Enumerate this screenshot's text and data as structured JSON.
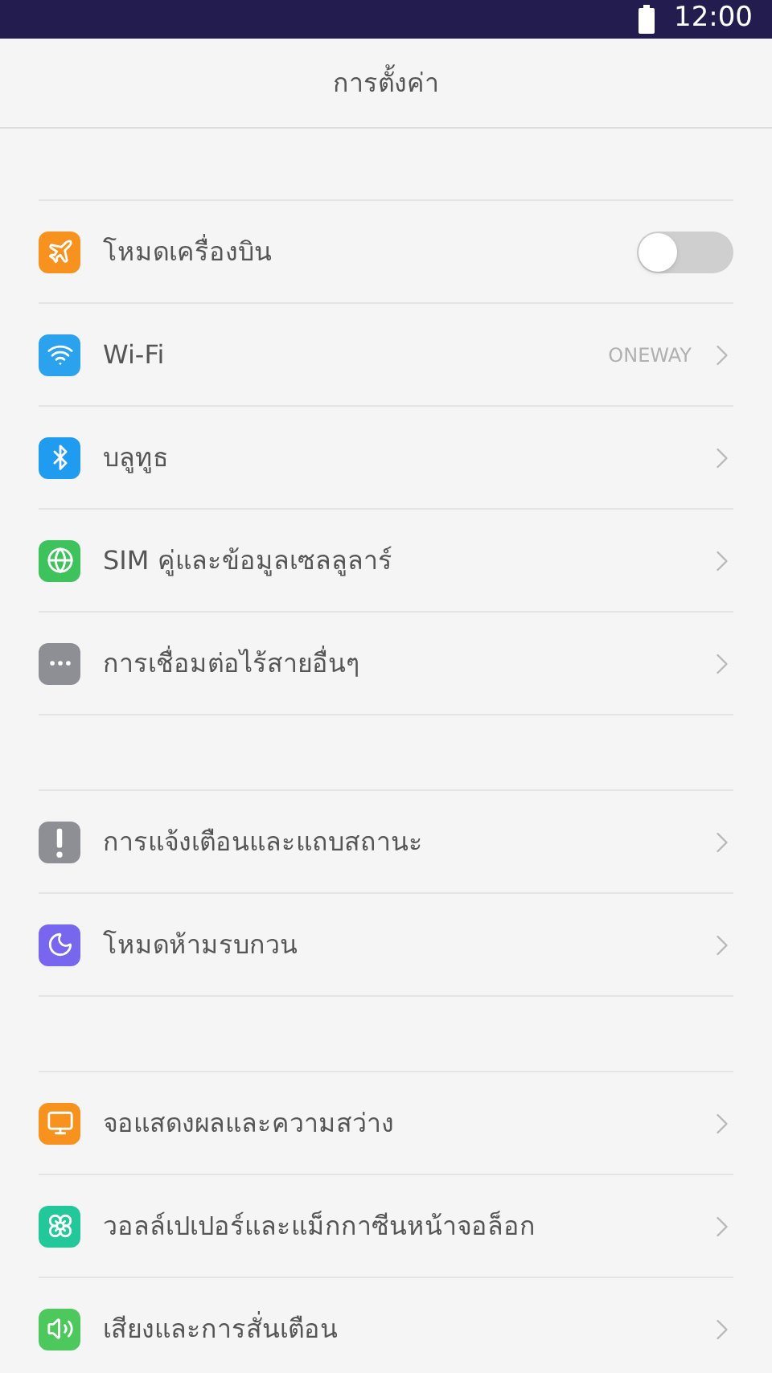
{
  "status_bar": {
    "time": "12:00"
  },
  "header": {
    "title": "การตั้งค่า"
  },
  "sections": [
    {
      "items": [
        {
          "kind": "toggle",
          "label": "โหมดเครื่องบิน",
          "color": "#f7921e",
          "on": false
        },
        {
          "kind": "link",
          "label": "Wi-Fi",
          "color": "#2ba2ee",
          "value": "ONEWAY"
        },
        {
          "kind": "link",
          "label": "บลูทูธ",
          "color": "#1f9bef"
        },
        {
          "kind": "link",
          "label": "SIM คู่และข้อมูลเซลลูลาร์",
          "color": "#3ec25c"
        },
        {
          "kind": "link",
          "label": "การเชื่อมต่อไร้สายอื่นๆ",
          "color": "#8e8f94"
        }
      ]
    },
    {
      "items": [
        {
          "kind": "link",
          "label": "การแจ้งเตือนและแถบสถานะ",
          "color": "#8e8f94"
        },
        {
          "kind": "link",
          "label": "โหมดห้ามรบกวน",
          "color": "#7767ee"
        }
      ]
    },
    {
      "items": [
        {
          "kind": "link",
          "label": "จอแสดงผลและความสว่าง",
          "color": "#f7921e"
        },
        {
          "kind": "link",
          "label": "วอลล์เปเปอร์และแม็กกาซีนหน้าจอล็อก",
          "color": "#22c79a"
        },
        {
          "kind": "link",
          "label": "เสียงและการสั่นเตือน",
          "color": "#4cc85c"
        }
      ]
    }
  ]
}
